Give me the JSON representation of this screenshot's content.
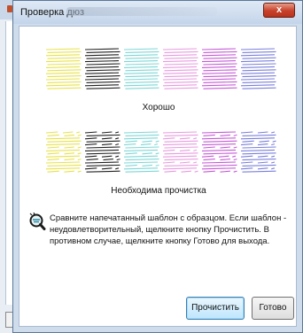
{
  "dialog": {
    "title": "Проверка дюз",
    "close_label": "x"
  },
  "patterns": {
    "good_label": "Хорошо",
    "bad_label": "Необходима прочистка",
    "colors": [
      "#e8e24a",
      "#222222",
      "#7fd6d6",
      "#e79be0",
      "#c45bd6",
      "#7a7fdc"
    ]
  },
  "info": {
    "icon": "magnifier-nozzle-icon",
    "text": "Сравните напечатанный шаблон с образцом. Если шаблон - неудовлетворительный, щелкните кнопку Прочистить. В противном случае, щелкните кнопку Готово для выхода."
  },
  "buttons": {
    "clean_label": "Прочистить",
    "done_label": "Готово"
  }
}
